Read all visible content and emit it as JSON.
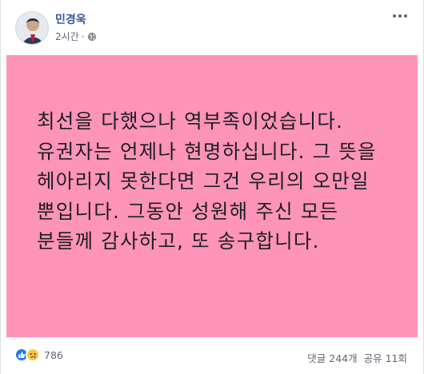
{
  "post": {
    "author": "민경욱",
    "time": "2시간",
    "privacy_icon": "globe-icon",
    "more_icon": "more-options-icon",
    "background_color": "#ff94b9",
    "text": "최선을 다했으나 역부족이었습니다. 유권자는 언제나 현명하십니다. 그 뜻을 헤아리지 못한다면 그건 우리의 오만일 뿐입니다. 그동안 성원해 주신 모든 분들께 감사하고, 또 송구합니다."
  },
  "footer": {
    "reaction_icons": [
      "like-icon",
      "sad-icon"
    ],
    "reaction_count": "786",
    "comments": "댓글 244개",
    "shares": "공유 11회"
  }
}
